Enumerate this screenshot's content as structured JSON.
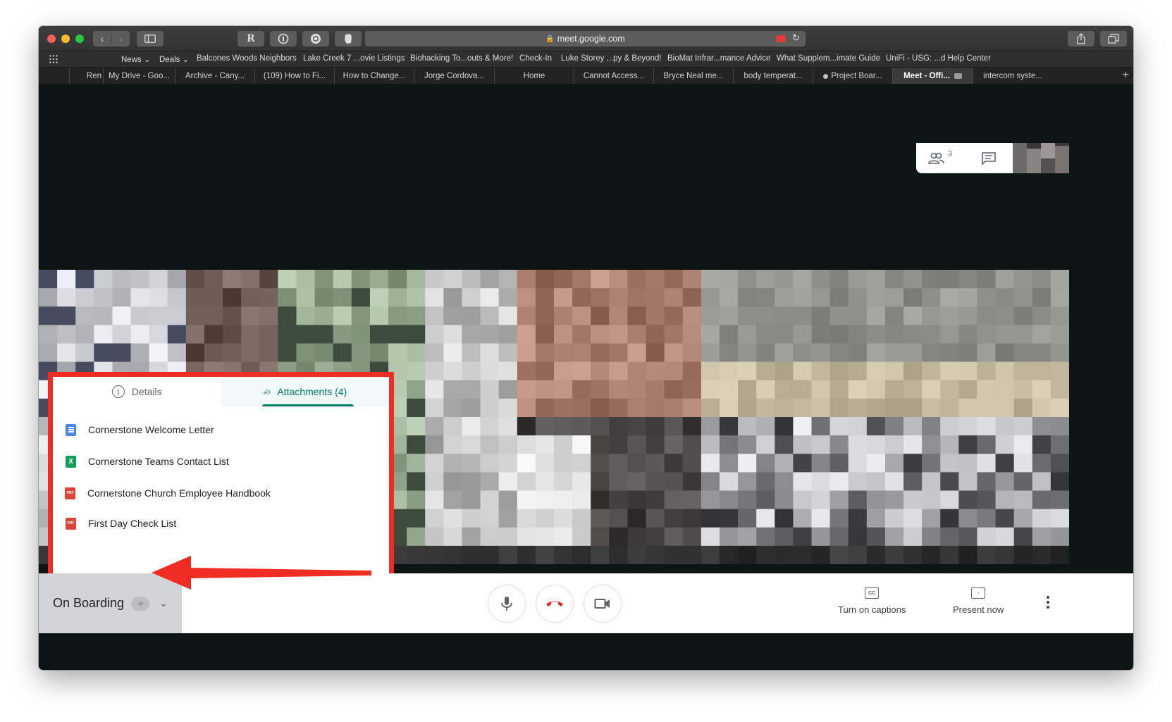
{
  "browser": {
    "url": "meet.google.com",
    "bookmarks": [
      "News",
      "Deals",
      "Balcones Woods Neighbors",
      "Lake Creek 7 ...ovie Listings",
      "Biohacking To...outs & More!",
      "Check-In",
      "Luke Storey ...py & Beyond!",
      "BioMat Infrar...mance Advice",
      "What Supplem...imate Guide",
      "UniFi - USG: ...d Help Center"
    ],
    "tabs": [
      "Ren",
      "My Drive - Goo...",
      "Archive - Cany...",
      "(109) How to Fi...",
      "How to Change...",
      "Jorge Cordova...",
      "Home",
      "Cannot Access...",
      "Bryce Neal me...",
      "body temperat...",
      "Project Boar...",
      "Meet - Offi...",
      "intercom syste..."
    ],
    "active_tab_index": 11,
    "extension_r": "R"
  },
  "meet": {
    "participant_count": "3",
    "details_tab": "Details",
    "attachments_tab": "Attachments (4)",
    "attachments": [
      {
        "name": "Cornerstone Welcome Letter",
        "type": "doc"
      },
      {
        "name": "Cornerstone Teams Contact List",
        "type": "sheet",
        "icon_letter": "X"
      },
      {
        "name": "Cornerstone Church Employee Handbook",
        "type": "pdf",
        "icon_letter": "PDF"
      },
      {
        "name": "First Day Check List",
        "type": "pdf",
        "icon_letter": "PDF"
      }
    ],
    "meeting_name": "On Boarding",
    "captions_label": "Turn on captions",
    "captions_icon_text": "CC",
    "present_label": "Present now"
  },
  "colors": {
    "annotation_red": "#f02d22",
    "accent_teal": "#00796b",
    "hangup_red": "#d93025"
  }
}
